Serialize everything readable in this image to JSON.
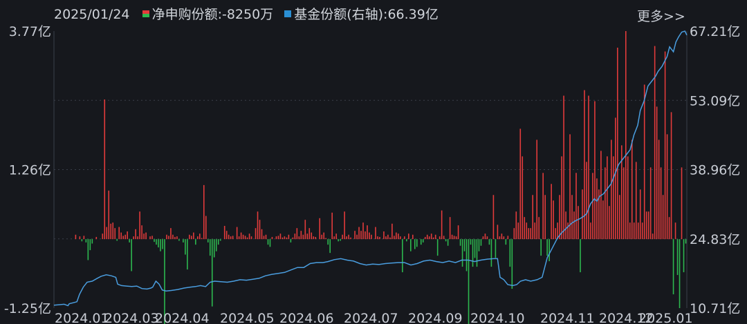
{
  "legend": {
    "date": "2025/01/24",
    "net_label": "净申购份额:-8250万",
    "share_label": "基金份额(右轴):66.39亿"
  },
  "more_link": "更多>>",
  "colors": {
    "background": "#16181d",
    "positive_bar": "#e33b3b",
    "negative_bar": "#2db84f",
    "share_line": "#4a9ee0",
    "grid": "#3a3f4a",
    "text": "#c8ccd4"
  },
  "chart_data": {
    "type": "bar+line",
    "left_axis": {
      "unit": "亿",
      "ylim": [
        -1.25,
        3.77
      ],
      "ticks": [
        "3.77亿",
        "1.26亿",
        "-1.25亿"
      ]
    },
    "right_axis": {
      "unit": "亿",
      "ylim": [
        10.71,
        67.21
      ],
      "ticks": [
        "67.21亿",
        "53.09亿",
        "38.96亿",
        "24.83亿",
        "10.71亿"
      ]
    },
    "x_ticks": [
      "2024.01",
      "2024.03",
      "2024.04",
      "2024.05",
      "2024.06",
      "2024.07",
      "2024.09",
      "2024.10",
      "2024.11",
      "2024.12",
      "2025.01"
    ],
    "series": [
      {
        "name": "净申购份额",
        "kind": "bar",
        "values": [
          0,
          0,
          0,
          0,
          0,
          0,
          0,
          0,
          0,
          0,
          0.08,
          0,
          0.05,
          -0.04,
          0.06,
          -0.06,
          -0.38,
          -0.2,
          -0.08,
          0,
          0.04,
          0,
          0,
          0.1,
          2.53,
          0.22,
          0.88,
          0.28,
          0.3,
          0.2,
          -0.03,
          0.22,
          0.12,
          0.06,
          0.08,
          0.14,
          -0.06,
          -0.58,
          0.05,
          0.18,
          0.05,
          0.5,
          0.25,
          0.1,
          0.12,
          0,
          0.05,
          0.06,
          -0.05,
          -0.1,
          -0.15,
          -0.22,
          -0.18,
          -1.58,
          0.08,
          0.06,
          0.2,
          0.08,
          0.04,
          0.05,
          -0.03,
          0,
          -0.06,
          -0.28,
          -0.55,
          0.08,
          0.06,
          0.12,
          -0.1,
          0.05,
          0.1,
          0.02,
          0.98,
          0.42,
          -0.06,
          -0.3,
          -1.22,
          -0.33,
          -0.22,
          -0.1,
          -0.03,
          0,
          0.24,
          0.15,
          0.08,
          0.05,
          0.06,
          0,
          0.22,
          0.05,
          0.12,
          0.08,
          0.06,
          0.03,
          0.1,
          0.05,
          0,
          0.2,
          0.5,
          0.35,
          0.18,
          0.06,
          0.08,
          -0.1,
          -0.14,
          0.04,
          0,
          0.05,
          0.06,
          0.1,
          0.03,
          0.05,
          0.03,
          0.08,
          -0.06,
          0.03,
          0.1,
          0.2,
          0.05,
          0.15,
          0.08,
          0.35,
          0.1,
          0.2,
          0.12,
          0.05,
          0.04,
          0,
          0.38,
          0.08,
          0.12,
          0.02,
          -0.1,
          -0.25,
          0.48,
          0.05,
          0.1,
          -0.04,
          -0.03,
          0.08,
          0.5,
          0.05,
          0.08,
          0.03,
          0,
          0.15,
          0.08,
          0.22,
          0.15,
          0.3,
          0.14,
          0.25,
          0.12,
          0.08,
          0,
          0.22,
          0.05,
          0.04,
          0,
          0.14,
          0.05,
          0.08,
          0.03,
          0.28,
          0.06,
          0.12,
          0.1,
          0.05,
          -0.6,
          0.05,
          -0.04,
          0.1,
          -0.22,
          0.08,
          -0.18,
          -0.14,
          0,
          -0.1,
          -0.06,
          0.04,
          0.08,
          0.05,
          0.1,
          0.03,
          0.08,
          -0.3,
          0.05,
          0.52,
          0.06,
          -0.04,
          -0.12,
          0.4,
          0.08,
          0.06,
          0.05,
          0.25,
          -0.12,
          -0.5,
          -0.22,
          -0.58,
          -1.58,
          -0.1,
          -0.5,
          -0.34,
          -0.5,
          -0.22,
          -0.12,
          0.05,
          0.1,
          0.05,
          -0.1,
          -0.5,
          0.8,
          -0.34,
          0.26,
          0.05,
          0.1,
          0.05,
          -0.1,
          0.06,
          -0.5,
          -0.9,
          0.2,
          0.5,
          0.3,
          2.0,
          1.5,
          0.4,
          0.3,
          0.2,
          0.2,
          0.8,
          0.3,
          1.8,
          0.4,
          -0.3,
          1.2,
          0.8,
          -0.3,
          -0.4,
          1.0,
          0.7,
          0.2,
          0.3,
          0.8,
          1.5,
          2.6,
          0.5,
          0.3,
          1.9,
          0.8,
          0.5,
          1.2,
          0.6,
          -0.6,
          0.9,
          2.7,
          1.4,
          2.6,
          0.3,
          1.2,
          2.5,
          1.1,
          0.9,
          1.6,
          0.7,
          1.3,
          1.5,
          0.6,
          1.8,
          1.5,
          2.2,
          3.47,
          0.8,
          1.7,
          1.3,
          3.77,
          1.5,
          0.3,
          1.8,
          0.3,
          1.4,
          0.3,
          0.9,
          0.3,
          2.8,
          0.5,
          0.5,
          1.3,
          0.1,
          3.5,
          2.4,
          1.8,
          1.3,
          0.8,
          3.4,
          1.9,
          0.4,
          2.3,
          -1.0,
          0.3,
          -0.65,
          -1.25,
          1.3,
          -0.6,
          -0.08
        ],
        "index_range": [
          0,
          341
        ]
      },
      {
        "name": "基金份额(右轴)",
        "kind": "line",
        "points": [
          [
            0,
            11.3
          ],
          [
            8,
            11.4
          ],
          [
            16,
            11.5
          ],
          [
            22,
            11.2
          ],
          [
            24,
            11.6
          ],
          [
            30,
            11.8
          ],
          [
            36,
            12.0
          ],
          [
            40,
            13.5
          ],
          [
            46,
            15.0
          ],
          [
            52,
            16.0
          ],
          [
            60,
            16.2
          ],
          [
            68,
            16.8
          ],
          [
            74,
            17.2
          ],
          [
            82,
            17.5
          ],
          [
            90,
            17.3
          ],
          [
            97,
            17.0
          ],
          [
            100,
            15.6
          ],
          [
            106,
            15.3
          ],
          [
            114,
            15.2
          ],
          [
            122,
            15.1
          ],
          [
            130,
            15.2
          ],
          [
            138,
            14.7
          ],
          [
            146,
            14.6
          ],
          [
            152,
            14.8
          ],
          [
            155,
            15.0
          ],
          [
            160,
            16.2
          ],
          [
            165,
            15.6
          ],
          [
            170,
            14.4
          ],
          [
            176,
            14.2
          ],
          [
            184,
            14.3
          ],
          [
            194,
            14.5
          ],
          [
            204,
            14.8
          ],
          [
            214,
            15.0
          ],
          [
            222,
            15.1
          ],
          [
            230,
            15.3
          ],
          [
            238,
            15.1
          ],
          [
            245,
            16.0
          ],
          [
            252,
            16.2
          ],
          [
            262,
            16.1
          ],
          [
            272,
            16.0
          ],
          [
            282,
            16.2
          ],
          [
            292,
            16.5
          ],
          [
            302,
            16.4
          ],
          [
            312,
            16.6
          ],
          [
            322,
            16.8
          ],
          [
            332,
            17.3
          ],
          [
            342,
            17.6
          ],
          [
            352,
            17.8
          ],
          [
            362,
            18.0
          ],
          [
            372,
            18.5
          ],
          [
            382,
            19.0
          ],
          [
            392,
            19.0
          ],
          [
            402,
            19.8
          ],
          [
            412,
            20.0
          ],
          [
            422,
            20.0
          ],
          [
            430,
            20.2
          ],
          [
            440,
            20.6
          ],
          [
            450,
            20.8
          ],
          [
            460,
            20.5
          ],
          [
            470,
            20.3
          ],
          [
            480,
            19.8
          ],
          [
            490,
            19.5
          ],
          [
            500,
            19.7
          ],
          [
            510,
            19.6
          ],
          [
            520,
            19.8
          ],
          [
            530,
            19.9
          ],
          [
            540,
            20.0
          ],
          [
            550,
            20.0
          ],
          [
            560,
            19.5
          ],
          [
            570,
            19.8
          ],
          [
            580,
            20.3
          ],
          [
            590,
            20.5
          ],
          [
            600,
            20.2
          ],
          [
            610,
            20.0
          ],
          [
            620,
            20.3
          ],
          [
            630,
            20.0
          ],
          [
            640,
            20.5
          ],
          [
            650,
            20.5
          ],
          [
            660,
            20.2
          ],
          [
            670,
            20.5
          ],
          [
            680,
            20.7
          ],
          [
            690,
            20.8
          ],
          [
            696,
            20.8
          ],
          [
            700,
            17.0
          ],
          [
            706,
            16.5
          ],
          [
            712,
            15.5
          ],
          [
            720,
            15.3
          ],
          [
            726,
            15.5
          ],
          [
            732,
            16.2
          ],
          [
            740,
            16.5
          ],
          [
            748,
            16.2
          ],
          [
            758,
            16.5
          ],
          [
            766,
            17.0
          ],
          [
            774,
            21.0
          ],
          [
            782,
            23.0
          ],
          [
            790,
            25.0
          ],
          [
            796,
            26.0
          ],
          [
            804,
            27.0
          ],
          [
            812,
            28.0
          ],
          [
            818,
            28.5
          ],
          [
            826,
            29.0
          ],
          [
            832,
            29.5
          ],
          [
            836,
            30.0
          ],
          [
            842,
            32.0
          ],
          [
            848,
            33.0
          ],
          [
            852,
            32.5
          ],
          [
            856,
            33.5
          ],
          [
            862,
            34.0
          ],
          [
            868,
            35.0
          ],
          [
            874,
            36.0
          ],
          [
            880,
            38.0
          ],
          [
            886,
            40.0
          ],
          [
            892,
            41.0
          ],
          [
            898,
            42.0
          ],
          [
            904,
            43.0
          ],
          [
            910,
            46.0
          ],
          [
            916,
            48.0
          ],
          [
            920,
            51.0
          ],
          [
            926,
            53.0
          ],
          [
            932,
            56.0
          ],
          [
            938,
            57.0
          ],
          [
            944,
            58.0
          ],
          [
            948,
            59.0
          ],
          [
            954,
            60.0
          ],
          [
            958,
            61.0
          ],
          [
            962,
            62.0
          ],
          [
            966,
            64.0
          ],
          [
            972,
            63.0
          ],
          [
            976,
            65.0
          ],
          [
            980,
            66.0
          ],
          [
            985,
            67.0
          ],
          [
            990,
            67.21
          ],
          [
            993,
            66.39
          ]
        ],
        "points_x_unit": "pixel-free index 0–993 along time axis"
      }
    ],
    "grid": true
  }
}
